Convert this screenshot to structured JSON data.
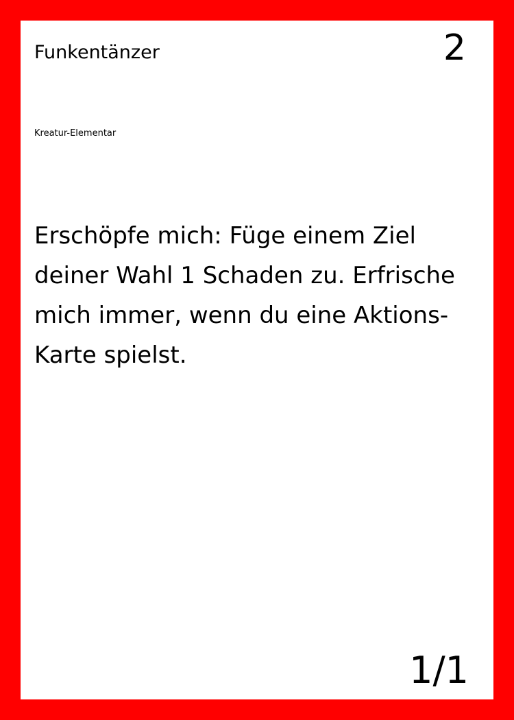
{
  "card": {
    "name": "Funkentänzer",
    "cost": "2",
    "type_line": "Kreatur-Elementar",
    "rules_text": "Erschöpfe mich: Füge einem Ziel deiner Wahl 1 Schaden zu. Erfrische mich immer, wenn du eine Aktions-Karte spielst.",
    "stats": "1/1"
  },
  "colors": {
    "border": "#ff0000",
    "background": "#ffffff",
    "text": "#000000"
  }
}
